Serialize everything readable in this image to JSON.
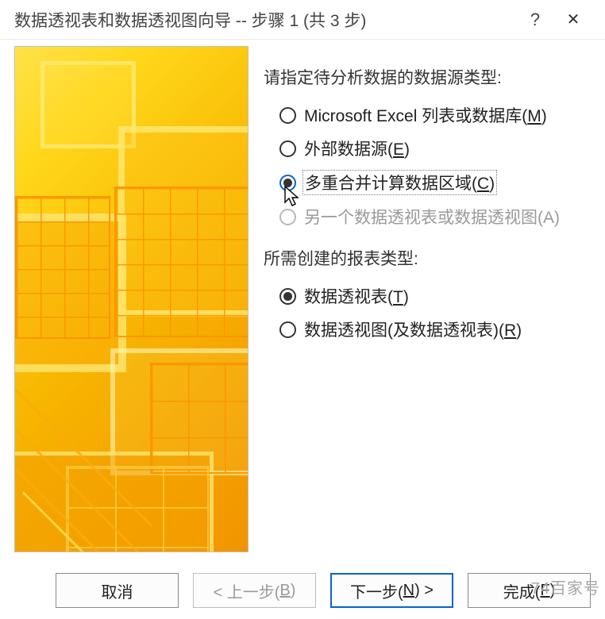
{
  "titlebar": {
    "title": "数据透视表和数据透视图向导 -- 步骤 1 (共 3 步)",
    "help": "?",
    "close": "✕"
  },
  "section1": {
    "label": "请指定待分析数据的数据源类型:",
    "options": [
      {
        "text": "Microsoft Excel 列表或数据库(",
        "accel": "M",
        "tail": ")",
        "selected": false,
        "disabled": false,
        "focused": false
      },
      {
        "text": "外部数据源(",
        "accel": "E",
        "tail": ")",
        "selected": false,
        "disabled": false,
        "focused": false
      },
      {
        "text": "多重合并计算数据区域(",
        "accel": "C",
        "tail": ")",
        "selected": true,
        "disabled": false,
        "focused": true
      },
      {
        "text": "另一个数据透视表或数据透视图(A)",
        "accel": "",
        "tail": "",
        "selected": false,
        "disabled": true,
        "focused": false
      }
    ]
  },
  "section2": {
    "label": "所需创建的报表类型:",
    "options": [
      {
        "text": "数据透视表(",
        "accel": "T",
        "tail": ")",
        "selected": true,
        "disabled": false
      },
      {
        "text": "数据透视图(及数据透视表)(",
        "accel": "R",
        "tail": ")",
        "selected": false,
        "disabled": false
      }
    ]
  },
  "buttons": {
    "cancel": "取消",
    "back_prefix": "< 上一步(",
    "back_accel": "B",
    "back_suffix": ")",
    "next_prefix": "下一步(",
    "next_accel": "N",
    "next_suffix": ") >",
    "finish_prefix": "完成(",
    "finish_accel": "F",
    "finish_suffix": ")"
  },
  "watermark": "74百家号"
}
